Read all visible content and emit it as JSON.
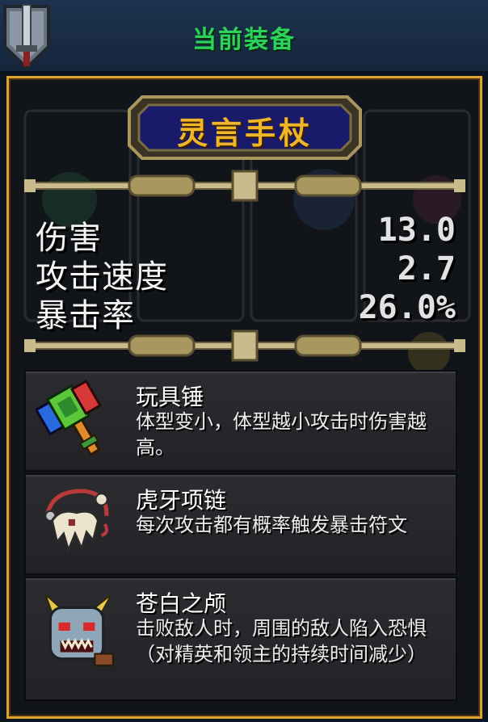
{
  "header": {
    "title": "当前装备"
  },
  "weapon": {
    "name": "灵言手杖"
  },
  "stats": [
    {
      "label": "伤害",
      "value": "13.0"
    },
    {
      "label": "攻击速度",
      "value": "2.7"
    },
    {
      "label": "暴击率",
      "value": "26.0%"
    }
  ],
  "items": [
    {
      "name": "玩具锤",
      "desc": "体型变小，体型越小攻击时伤害越高。",
      "icon": "toy-hammer-icon"
    },
    {
      "name": "虎牙项链",
      "desc": "每次攻击都有概率触发暴击符文",
      "icon": "tiger-tooth-necklace-icon"
    },
    {
      "name": "苍白之颅",
      "desc": "击败敌人时，周围的敌人陷入恐惧（对精英和领主的持续时间减少）",
      "icon": "pale-skull-icon"
    }
  ],
  "colors": {
    "accent": "#e0a22a",
    "title_green": "#2bd35a",
    "weapon_gold": "#f0b62a"
  }
}
